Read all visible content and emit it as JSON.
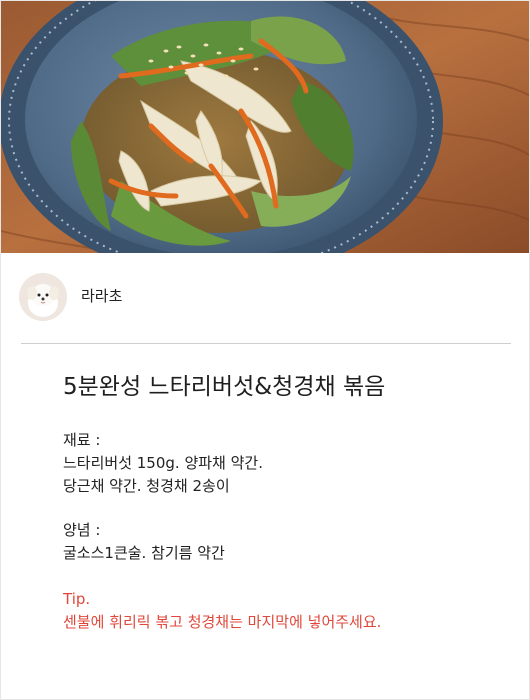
{
  "author": {
    "name": "라라초"
  },
  "recipe": {
    "title": "5분완성 느타리버섯&청경채 볶음",
    "ingredients_label": "재료 :",
    "ingredients_line1": "느타리버섯 150g. 양파채 약간.",
    "ingredients_line2": "당근채 약간. 청경채 2송이",
    "seasoning_label": "양념 :",
    "seasoning_line1": "굴소스1큰술. 참기름 약간",
    "tip_label": "Tip.",
    "tip_text": "센불에 휘리릭 볶고 청경채는 마지막에 넣어주세요."
  },
  "colors": {
    "tip": "#e0483b",
    "divider": "#cfcfcf"
  }
}
